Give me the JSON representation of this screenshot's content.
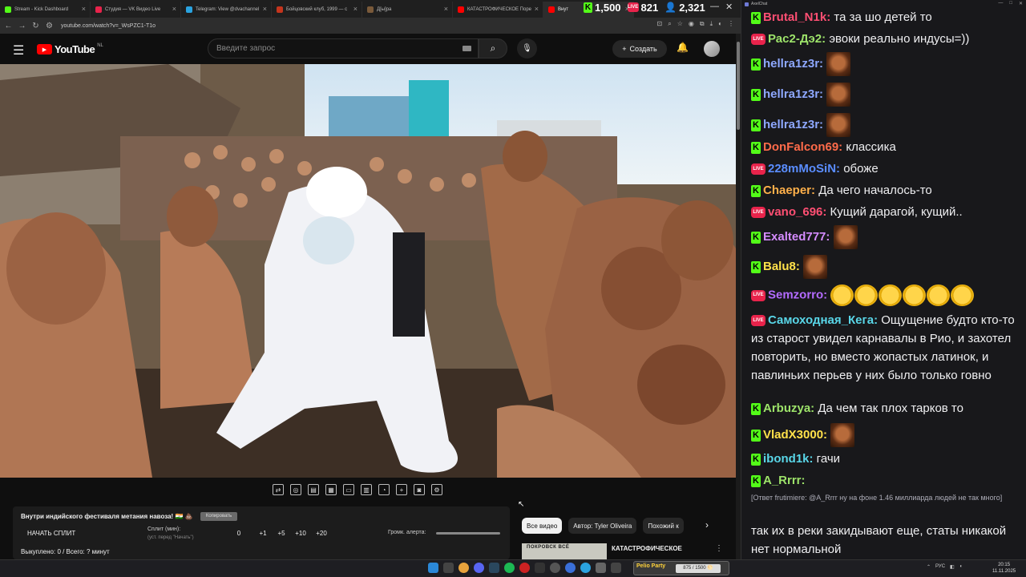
{
  "browser": {
    "tabs": [
      {
        "label": "Stream - Kick Dashboard",
        "color": "#53fc18"
      },
      {
        "label": "Студия — VK Видео Live",
        "color": "#e8234b"
      },
      {
        "label": "Telegram: View @dvachannel",
        "color": "#2aa3e0"
      },
      {
        "label": "Бойцовский клуб, 1999 — с",
        "color": "#c5351d"
      },
      {
        "label": "Д[ы]ра",
        "color": "#7a5a3a"
      },
      {
        "label": "КАТАСТРОФИЧЕСКОЕ Поре",
        "color": "#ff0000"
      },
      {
        "label": "Внут",
        "color": "#ff0000"
      }
    ],
    "url": "youtube.com/watch?v=_WsPZC1-T1o"
  },
  "overlay": {
    "kick_viewers": "1,500",
    "vk_viewers": "821",
    "total_viewers": "2,321",
    "kick_badge": "K",
    "live_badge": "LIVE"
  },
  "youtube": {
    "logo_text": "YouTube",
    "region": "NL",
    "search_placeholder": "Введите запрос",
    "create_label": "Создать"
  },
  "split_panel": {
    "title": "Внутри индийского фестиваля метания навоза! 🇮🇳 💩",
    "copy_button": "Копировать",
    "start_label": "НАЧАТЬ СПЛИТ",
    "split_label": "Сплит (мин):",
    "split_hint": "(уст. перед \"Начать\")",
    "values": [
      "0",
      "+1",
      "+5",
      "+10",
      "+20"
    ],
    "alert_label": "Громк. алерта:",
    "footer": "Выкуплено: 0 / Всего: ? минут"
  },
  "chips": [
    "Все видео",
    "Автор: Tyler Oliveira",
    "Похожий к"
  ],
  "recommended": {
    "thumb_text": "ПОКРОВСК ВСЁ",
    "title": "КАТАСТРОФИЧЕСКОЕ"
  },
  "chat": {
    "app_title": "AxelChat",
    "messages": [
      {
        "platform": "kick",
        "nick": "Brutal_N1k:",
        "color": "#ff4f73",
        "text": "та за шо детей то",
        "emotes": 0
      },
      {
        "platform": "vk",
        "nick": "Рас2-Дэ2:",
        "color": "#9de36a",
        "text": "эвоки реально индусы=))",
        "emotes": 0
      },
      {
        "platform": "kick",
        "nick": "hellra1z3r:",
        "color": "#8ea8ff",
        "text": "",
        "emotes": 1
      },
      {
        "platform": "kick",
        "nick": "hellra1z3r:",
        "color": "#8ea8ff",
        "text": "",
        "emotes": 1
      },
      {
        "platform": "kick",
        "nick": "hellra1z3r:",
        "color": "#8ea8ff",
        "text": "",
        "emotes": 1
      },
      {
        "platform": "kick",
        "nick": "DonFalcon69:",
        "color": "#ff6b4a",
        "text": "классика",
        "emotes": 0
      },
      {
        "platform": "vk",
        "nick": "228mMoSiN:",
        "color": "#5a8dff",
        "text": "обоже",
        "emotes": 0
      },
      {
        "platform": "kick",
        "nick": "Chaeper:",
        "color": "#ffb04a",
        "text": "Да чего началось-то",
        "emotes": 0
      },
      {
        "platform": "vk",
        "nick": "vano_696:",
        "color": "#ff4f73",
        "text": "Кущий дарагой, кущий..",
        "emotes": 0
      },
      {
        "platform": "kick",
        "nick": "Exalted777:",
        "color": "#d58cff",
        "text": "",
        "emotes": 1
      },
      {
        "platform": "kick",
        "nick": "Balu8:",
        "color": "#ffe14a",
        "text": "",
        "emotes": 1
      },
      {
        "platform": "vk",
        "nick": "Semzorro:",
        "color": "#b36bff",
        "text": "",
        "emotes": 6
      },
      {
        "platform": "vk",
        "nick": "Самоходная_Кега:",
        "color": "#59d6e8",
        "text": "Ощущение будто кто-то из старост увидел карнавалы в Рио, и захотел повторить, но вместо жопастых латинок, и павлиньих перьев у них было только говно",
        "emotes": 0
      },
      {
        "platform": "kick",
        "nick": "Arbuzya:",
        "color": "#9de36a",
        "text": "Да чем так плох тарков то",
        "emotes": 0
      },
      {
        "platform": "kick",
        "nick": "VladX3000:",
        "color": "#ffe14a",
        "text": "",
        "emotes": 1
      },
      {
        "platform": "kick",
        "nick": "ibond1k:",
        "color": "#59d6e8",
        "text": "гачи",
        "emotes": 0
      },
      {
        "platform": "kick",
        "nick": "A_Rrrr:",
        "color": "#9de36a",
        "text": "",
        "emotes": 0
      }
    ],
    "reply_prefix": "[Ответ frutimiere: @A_Rrrr ну на фоне 1.46 миллиарда людей не так много]",
    "reply_text": "так их в реки закидывают еще, статы никакой нет нормальной"
  },
  "taskbar": {
    "widget_left": "Pelio Party",
    "widget_progress": "875 / 1500 🌕",
    "tray_lang": "РУС",
    "time": "20:15",
    "date": "11.11.2025"
  }
}
